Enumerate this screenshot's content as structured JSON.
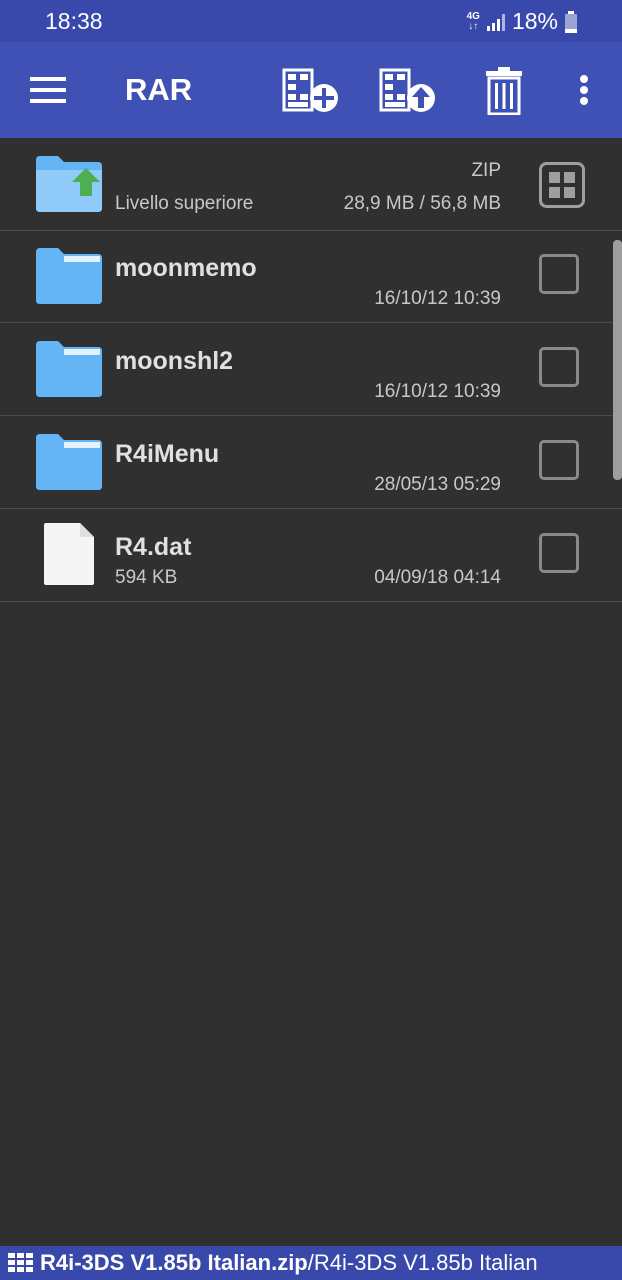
{
  "status": {
    "time": "18:38",
    "network": "4G",
    "battery": "18%"
  },
  "toolbar": {
    "title": "RAR",
    "menu_icon": "hamburger-menu-icon",
    "add_icon": "archive-add-icon",
    "extract_icon": "archive-extract-icon",
    "delete_icon": "trash-icon",
    "more_icon": "more-vert-icon"
  },
  "list": {
    "parent": {
      "label": "Livello superiore",
      "type": "ZIP",
      "size": "28,9 MB / 56,8 MB"
    },
    "items": [
      {
        "name": "moonmemo",
        "date": "16/10/12 10:39",
        "size": ""
      },
      {
        "name": "moonshl2",
        "date": "16/10/12 10:39",
        "size": ""
      },
      {
        "name": "R4iMenu",
        "date": "28/05/13 05:29",
        "size": ""
      },
      {
        "name": "R4.dat",
        "date": "04/09/18 04:14",
        "size": "594 KB"
      }
    ]
  },
  "path": {
    "archive": "R4i-3DS V1.85b Italian.zip",
    "folder": "/R4i-3DS V1.85b Italian"
  },
  "colors": {
    "toolbar": "#3f51b5",
    "status": "#3949ab",
    "background": "#303030",
    "folder": "#64b5f6",
    "up_arrow": "#4caf50"
  }
}
